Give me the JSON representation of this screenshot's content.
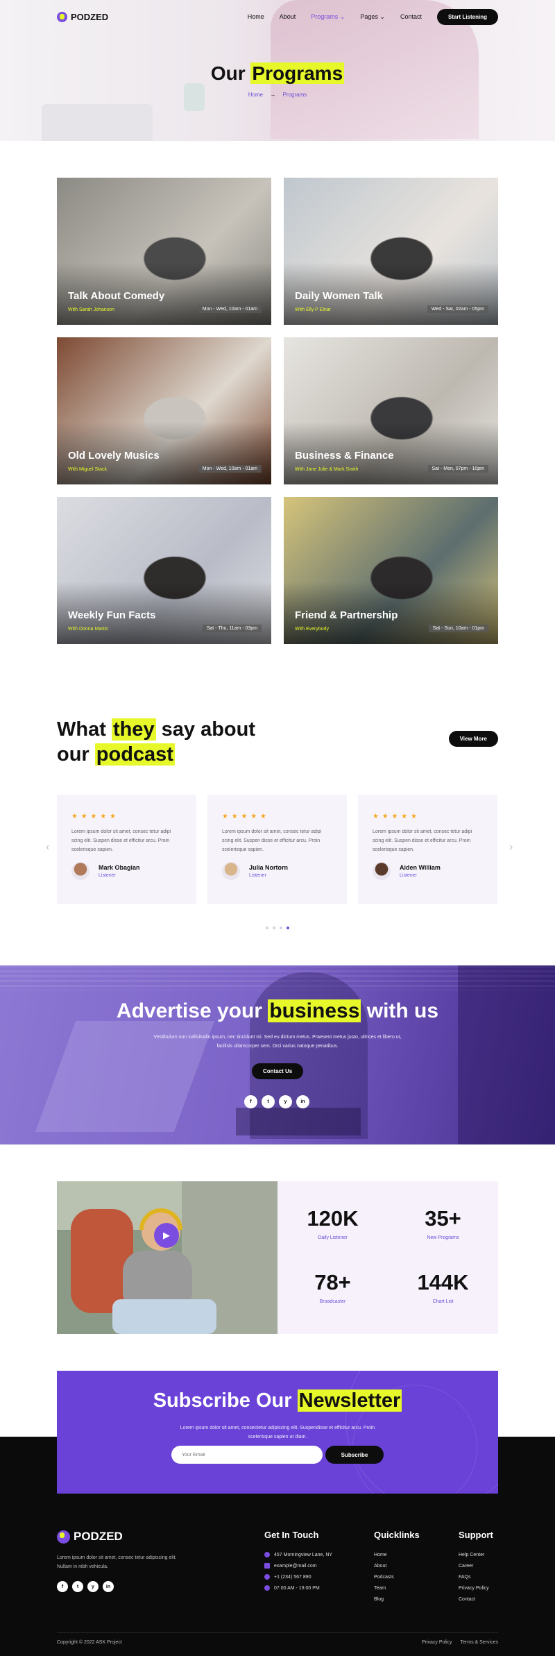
{
  "header": {
    "logo": "PODZED",
    "nav": [
      "Home",
      "About",
      "Programs",
      "Pages",
      "Contact"
    ],
    "cta": "Start Listening"
  },
  "hero": {
    "title_plain": "Our",
    "title_highlight": "Programs",
    "breadcrumb": [
      "Home",
      "Programs"
    ]
  },
  "programs": [
    {
      "title": "Talk About Comedy",
      "host": "With Sarah Johanson",
      "time": "Mon - Wed, 10am - 01am",
      "colors": [
        "#8c8a84",
        "#c7c3bb",
        "#4a4a4a"
      ]
    },
    {
      "title": "Daily Women Talk",
      "host": "With Elly P Elnar",
      "time": "Wed - Sat, 02am - 05pm",
      "colors": [
        "#bfc7ce",
        "#e8e3de",
        "#3b3a3a"
      ]
    },
    {
      "title": "Old Lovely Musics",
      "host": "With Miguel Stack",
      "time": "Mon - Wed, 10am - 01am",
      "colors": [
        "#7e4a33",
        "#ded8cf",
        "#c9c4be"
      ]
    },
    {
      "title": "Business & Finance",
      "host": "With Jane Julie & Mark Smith",
      "time": "Sat - Mon, 07pm - 10pm",
      "colors": [
        "#e7e5e1",
        "#bdb8b0",
        "#3a3a3d"
      ]
    },
    {
      "title": "Weekly Fun Facts",
      "host": "With Donna Martin",
      "time": "Sat - Thu, 11am - 03pm",
      "colors": [
        "#dcdde2",
        "#b9bcc7",
        "#2f2c2c"
      ]
    },
    {
      "title": "Friend & Partnership",
      "host": "With Everybody",
      "time": "Sat - Sun, 10am - 01pm",
      "colors": [
        "#d6c47a",
        "#5d6e6f",
        "#2d2a2c"
      ]
    }
  ],
  "testimonials": {
    "heading_1": "What",
    "heading_hl1": "they",
    "heading_2": "say about",
    "heading_3": "our",
    "heading_hl2": "podcast",
    "view_more": "View More",
    "stars": "★ ★ ★ ★ ★",
    "items": [
      {
        "text": "Lorem ipsum dolor sit amet, consec tetur adipi scing elit. Suspen disse et efficitur arcu. Proin scelerisque sapien.",
        "name": "Mark Obagian",
        "role": "Listener",
        "avatar": "#b07a5a"
      },
      {
        "text": "Lorem ipsum dolor sit amet, consec tetur adipi scing elit. Suspen disse et efficitur arcu. Proin scelerisque sapien.",
        "name": "Julia Nortorn",
        "role": "Listener",
        "avatar": "#d8b58a"
      },
      {
        "text": "Lorem ipsum dolor sit amet, consec tetur adipi scing elit. Suspen disse et efficitur arcu. Proin scelerisque sapien.",
        "name": "Aiden William",
        "role": "Listener",
        "avatar": "#5a3a2a"
      }
    ],
    "prev": "‹",
    "next": "›"
  },
  "advert": {
    "title_1": "Advertise your",
    "title_hl": "business",
    "title_2": "with us",
    "text": "Vestibulum non sollicitudin ipsum, nec tincidunt mi. Sed eu dictum metus. Praesent metus justo, ultrices et libero ut, facilisis ullamcorper sem. Orci varius natoque penatibus.",
    "cta": "Contact Us",
    "socials": [
      "f",
      "t",
      "y",
      "in"
    ]
  },
  "stats": [
    {
      "value": "120K",
      "label": "Daily Listener"
    },
    {
      "value": "35+",
      "label": "New Programs"
    },
    {
      "value": "78+",
      "label": "Broadcaster"
    },
    {
      "value": "144K",
      "label": "Chart List"
    }
  ],
  "newsletter": {
    "title_1": "Subscribe Our",
    "title_hl": "Newsletter",
    "text": "Lorem ipsum dolor sit amet, consectetur adipiscing elit. Suspendisse et efficitur arcu. Proin scelerisque sapien ut diam.",
    "placeholder": "Your Email",
    "button": "Subscribe"
  },
  "footer": {
    "logo": "PODZED",
    "description": "Lorem ipsum dolor sit amet, consec tetur adipiscing elit. Nullam in nibh vehicula.",
    "socials": [
      "f",
      "t",
      "y",
      "in"
    ],
    "contact_title": "Get In Touch",
    "contact": [
      "457 Morningview Lane, NY",
      "example@mail.com",
      "+1 (234) 567 890",
      "07.00 AM - 19.00 PM"
    ],
    "quick_title": "Quicklinks",
    "quick": [
      "Home",
      "About",
      "Podcasts",
      "Team",
      "Blog"
    ],
    "support_title": "Support",
    "support": [
      "Help Center",
      "Career",
      "FAQs",
      "Privacy Policy",
      "Contact"
    ],
    "copyright": "Copyright © 2022 ASK Project",
    "bottom_links": [
      "Privacy Policy",
      "Terms & Services"
    ]
  },
  "colors": {
    "accent": "#7b4ce0",
    "highlight": "#e6f829",
    "dark": "#0b0b0b"
  }
}
